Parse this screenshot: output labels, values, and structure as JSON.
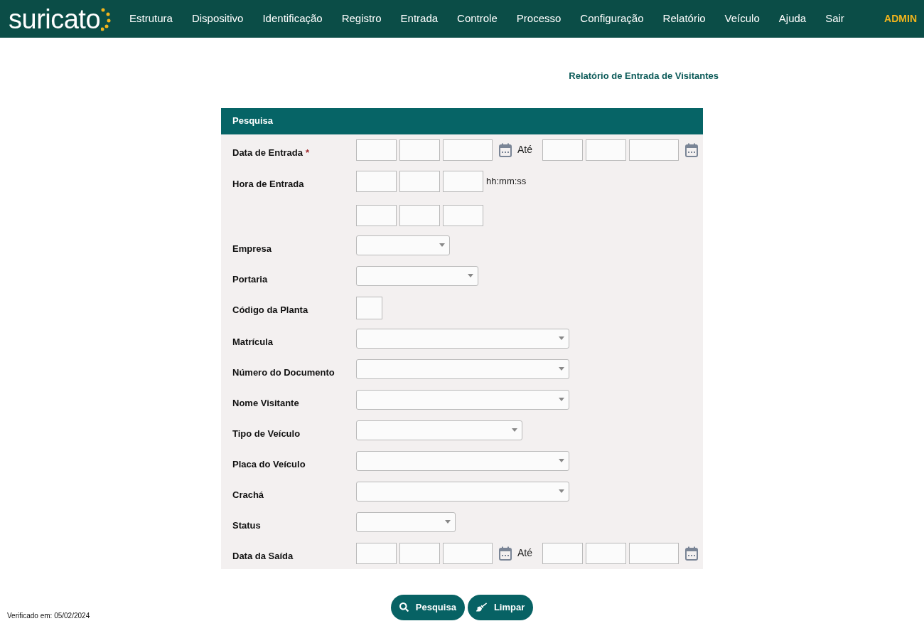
{
  "header": {
    "logo": "suricato",
    "menu": [
      "Estrutura",
      "Dispositivo",
      "Identificação",
      "Registro",
      "Entrada",
      "Controle",
      "Processo",
      "Configuração",
      "Relatório",
      "Veículo",
      "Ajuda",
      "Sair"
    ],
    "user": "ADMIN"
  },
  "page_title": "Relatório de Entrada de Visitantes",
  "panel": {
    "title": "Pesquisa",
    "fields": [
      {
        "kind": "date_range",
        "label": "Data de Entrada",
        "required": true,
        "required_mark": "*",
        "separator": "Até"
      },
      {
        "kind": "time",
        "label": "Hora de Entrada",
        "hint": "hh:mm:ss"
      },
      {
        "kind": "time"
      },
      {
        "kind": "select",
        "label": "Empresa"
      },
      {
        "kind": "select",
        "label": "Portaria"
      },
      {
        "kind": "text",
        "label": "Código da Planta"
      },
      {
        "kind": "select",
        "label": "Matrícula"
      },
      {
        "kind": "select",
        "label": "Número do Documento"
      },
      {
        "kind": "select",
        "label": "Nome Visitante"
      },
      {
        "kind": "select",
        "label": "Tipo de Veículo"
      },
      {
        "kind": "select",
        "label": "Placa do Veículo"
      },
      {
        "kind": "select",
        "label": "Crachá"
      },
      {
        "kind": "select",
        "label": "Status"
      },
      {
        "kind": "date_range",
        "label": "Data da Saída",
        "separator": "Até"
      }
    ]
  },
  "buttons": [
    {
      "kind": "search",
      "label": "Pesquisa"
    },
    {
      "kind": "clear",
      "label": "Limpar"
    }
  ],
  "footer": "Verificado em: 05/02/2024"
}
